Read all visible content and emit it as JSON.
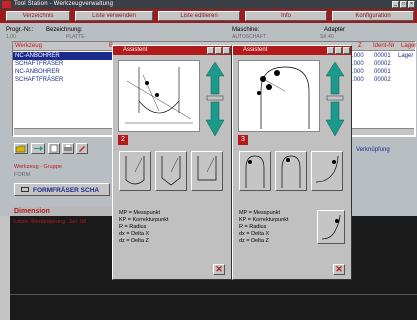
{
  "window": {
    "title": "Tool Station - Werkzeugverwaltung",
    "controls": [
      "_",
      "□",
      "×"
    ]
  },
  "menu": {
    "items": [
      "Verzeichnis",
      "Liste verwenden",
      "Liste editieren",
      "Info",
      "Konfiguration"
    ]
  },
  "header": {
    "prog_label": "Progr.-Nr.:",
    "prog_value": "1.00",
    "bez_label": "Bezeichnung:",
    "bez_value": "PLATTE",
    "maschine_label": "Maschine:",
    "maschine_value": "AUTOSCHAFT",
    "adapter_label": "Adapter",
    "adapter_value": "SK 40"
  },
  "table": {
    "col_werkzeug": "Werkzeug",
    "col_b": "B",
    "col_z": "Z",
    "col_ident": "Ident-Nr",
    "col_lager": "Lager",
    "rows": [
      {
        "name": "NC-ANBOHRER",
        "z": ".000",
        "ident": "00001",
        "lager": "Lager",
        "selected": true
      },
      {
        "name": "SCHAFTFRÄSER",
        "z": ".000",
        "ident": "00002",
        "lager": "",
        "selected": false
      },
      {
        "name": "NC-ANBOHRER",
        "z": ".000",
        "ident": "00001",
        "lager": "",
        "selected": false
      },
      {
        "name": "SCHAFTFRÄSER",
        "z": ".000",
        "ident": "00002",
        "lager": "",
        "selected": false
      }
    ]
  },
  "lower": {
    "gruppe_label": "Werkzeug - Gruppe",
    "gruppe_value": "FORM",
    "formfraser_label": "FORMFRÄSER SCHA",
    "verknuepfung_label": "Verknüpfung",
    "dimension_label": "Dimension",
    "status_text": "Letzte Wertänderung: Jan. 08"
  },
  "dialogs": [
    {
      "title": "Assistent",
      "badge": "2",
      "legend": [
        "MP = Messpunkt",
        "KP = Korrekturpunkt",
        "R = Radius",
        "dx = Delta X",
        "dz = Delta Z"
      ]
    },
    {
      "title": "Assistent",
      "badge": "3",
      "legend": [
        "MP = Messpunkt",
        "KP = Korrekturpunkt",
        "R = Radius",
        "dx = Delta X",
        "dz = Delta Z"
      ]
    }
  ],
  "colors": {
    "menubar": "#9a1c1c",
    "dialog_title": "#b31a1a",
    "arrow": "#1a9a8a",
    "selection": "#1a2b8c"
  }
}
